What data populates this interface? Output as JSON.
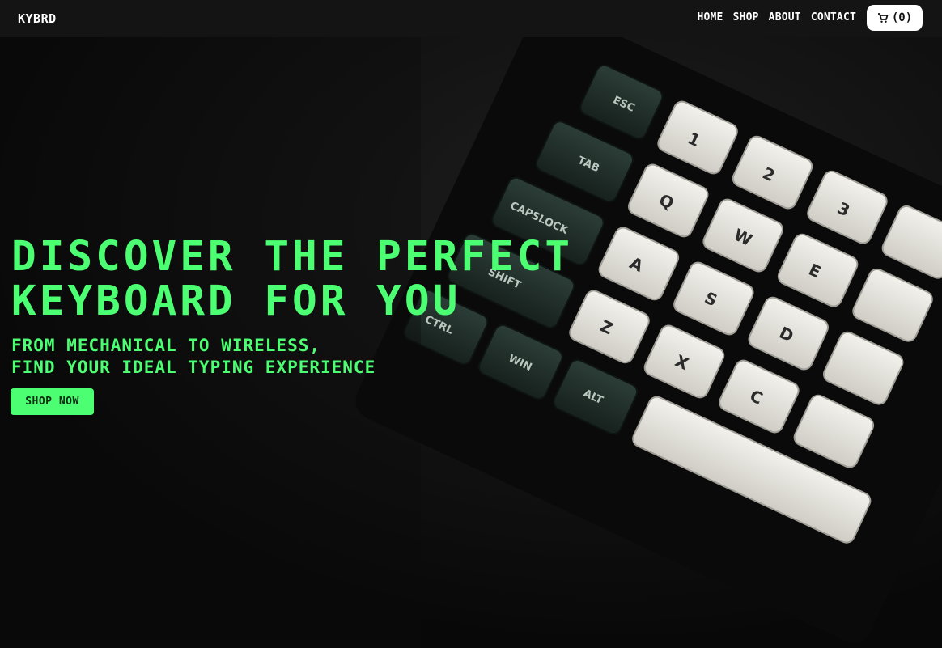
{
  "navbar": {
    "brand": "KYBRD",
    "links": [
      "HOME",
      "SHOP",
      "ABOUT",
      "CONTACT"
    ],
    "cart_label": "(0)",
    "cart_icon": "cart-icon"
  },
  "hero": {
    "headline_line1": "DISCOVER THE PERFECT",
    "headline_line2": "KEYBOARD FOR YOU",
    "sub_line1": "FROM MECHANICAL TO WIRELESS,",
    "sub_line2": "FIND YOUR IDEAL TYPING EXPERIENCE",
    "cta_label": "SHOP NOW",
    "accent_color": "#4cff72",
    "keycap_labels": [
      "ESC",
      "TAB",
      "CAPSLOCK",
      "SHIFT",
      "CTRL",
      "WIN",
      "ALT",
      "!\n1",
      "@\n2",
      "#\n3",
      "Q",
      "W",
      "E",
      "A",
      "S",
      "D",
      "Z",
      "X",
      "C"
    ]
  }
}
